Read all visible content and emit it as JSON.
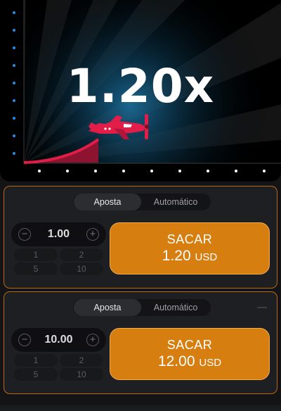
{
  "game": {
    "multiplier": "1.20x",
    "colors": {
      "background": "#000000",
      "curve": "#e11d48",
      "plane": "#e11d48",
      "axis_dots": "#3b82f6"
    }
  },
  "bets": [
    {
      "tabs": [
        "Aposta",
        "Automático"
      ],
      "active_tab": "Aposta",
      "amount": "1.00",
      "quick_amounts": [
        "1",
        "2",
        "5",
        "10"
      ],
      "cashout_label": "SACAR",
      "cashout_value": "1.20",
      "cashout_currency": "USD"
    },
    {
      "tabs": [
        "Aposta",
        "Automático"
      ],
      "active_tab": "Aposta",
      "amount": "10.00",
      "quick_amounts": [
        "1",
        "2",
        "5",
        "10"
      ],
      "cashout_label": "SACAR",
      "cashout_value": "12.00",
      "cashout_currency": "USD"
    }
  ],
  "colors": {
    "accent": "#d77e10",
    "panel_border": "#b8690f"
  }
}
